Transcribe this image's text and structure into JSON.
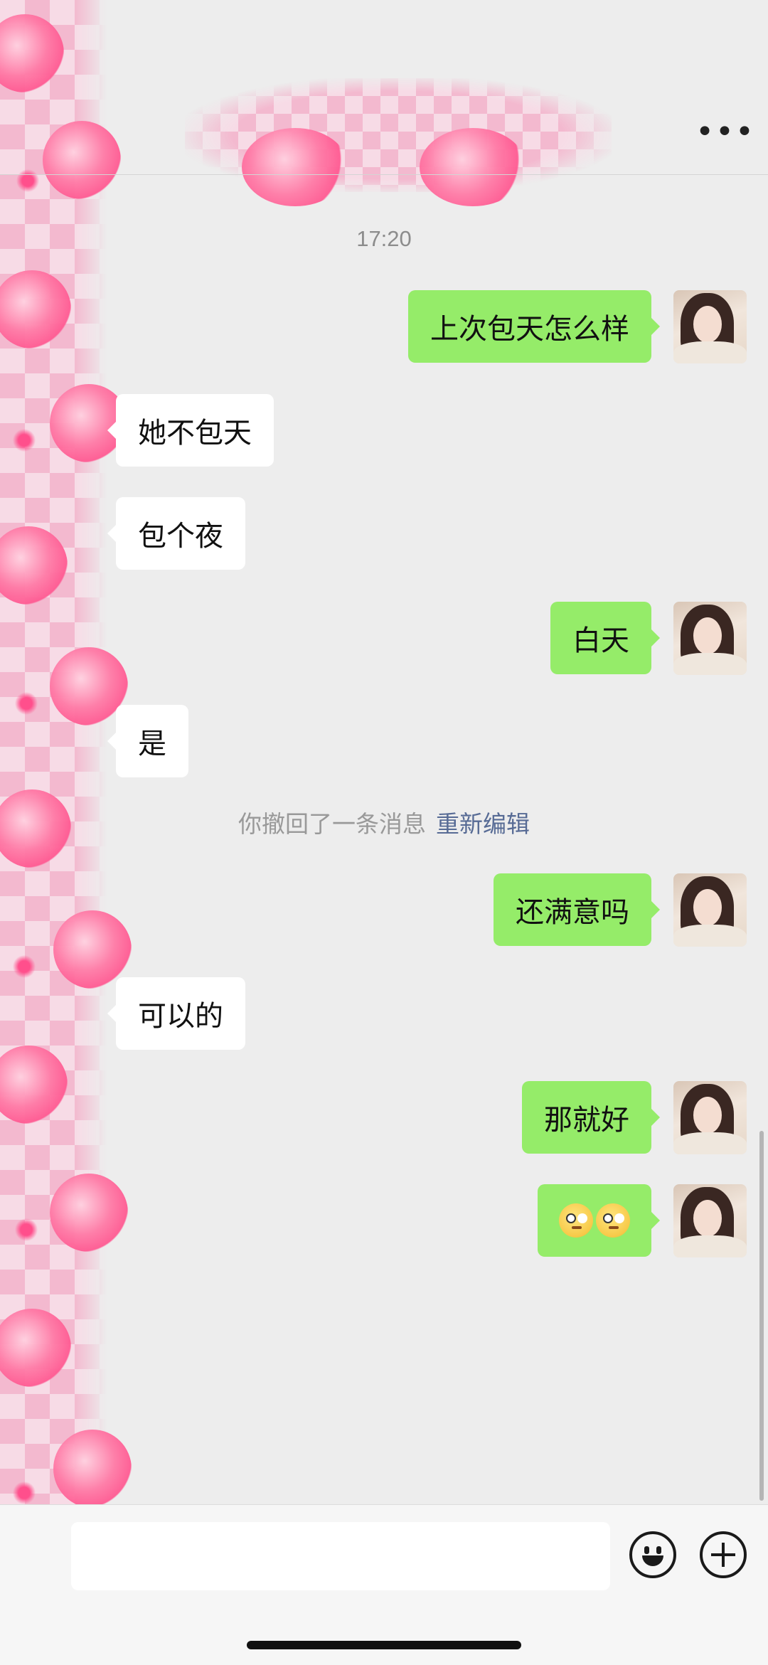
{
  "header": {
    "more_label": "•••"
  },
  "timestamp": "17:20",
  "messages": [
    {
      "dir": "out",
      "text": "上次包天怎么样"
    },
    {
      "dir": "in",
      "text": "她不包天"
    },
    {
      "dir": "in",
      "text": "包个夜"
    },
    {
      "dir": "out",
      "text": "白天"
    },
    {
      "dir": "in",
      "text": "是"
    },
    {
      "dir": "out",
      "text": "还满意吗"
    },
    {
      "dir": "in",
      "text": "可以的"
    },
    {
      "dir": "out",
      "text": "那就好"
    },
    {
      "dir": "out",
      "text": "",
      "emoji": [
        "thinking-face",
        "thinking-face"
      ]
    }
  ],
  "recall": {
    "text": "你撤回了一条消息",
    "edit_label": "重新编辑"
  },
  "colors": {
    "outgoing_bubble": "#95ec69",
    "incoming_bubble": "#ffffff",
    "background": "#ededed",
    "link": "#576b95"
  },
  "icons": {
    "emoji_button": "smile-icon",
    "more_button": "plus-icon"
  }
}
